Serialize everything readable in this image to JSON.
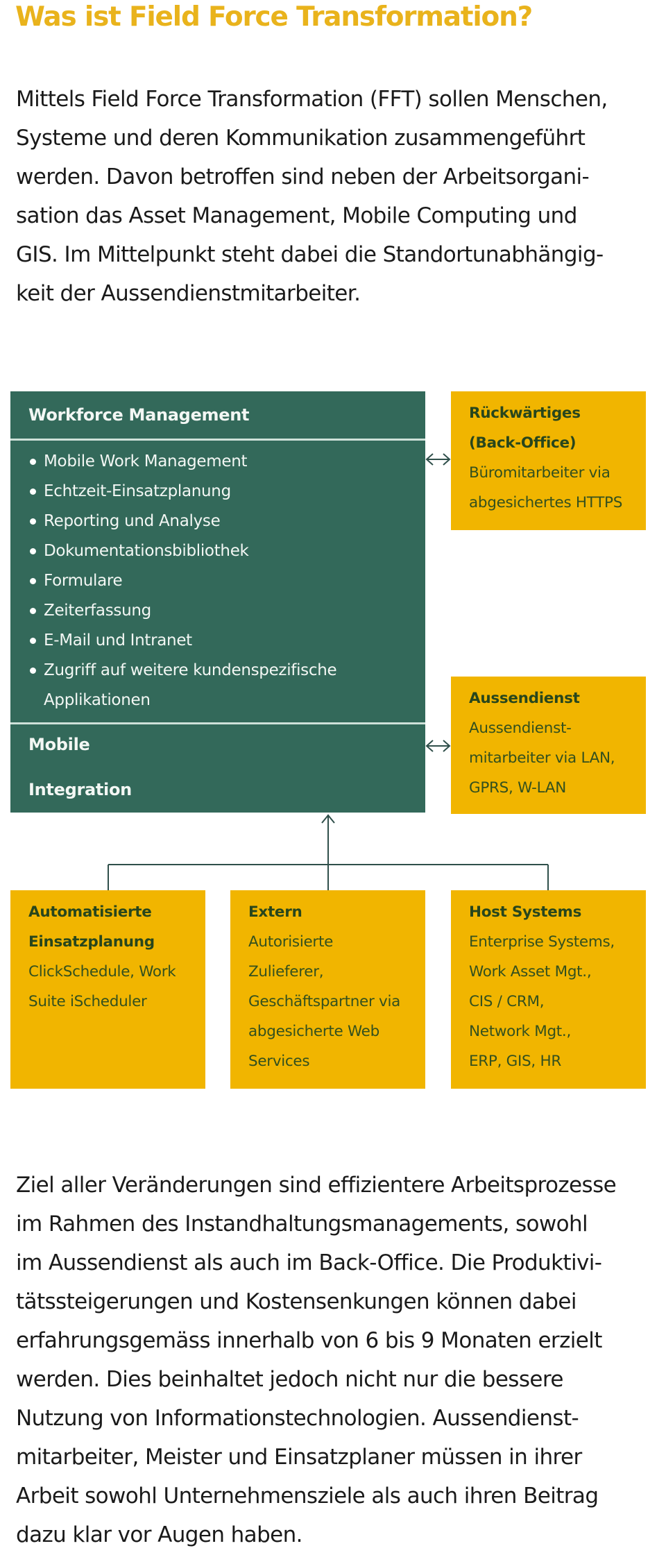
{
  "title": "Was ist Field Force Transformation?",
  "intro_lines": [
    "Mittels Field Force Transformation (FFT) sollen Menschen,",
    "Systeme und deren Kommunikation zusammengeführt",
    "werden. Davon betroffen sind neben der Arbeitsorgani-",
    "sation das Asset Management, Mobile Computing und",
    "GIS. Im Mittelpunkt steht dabei die Standortunabhängig-",
    "keit der Aussendienstmitarbeiter."
  ],
  "diagram": {
    "center": {
      "heading": "Workforce Management",
      "items": [
        "Mobile Work Management",
        "Echtzeit-Einsatzplanung",
        "Reporting und Analyse",
        "Dokumentationsbibliothek",
        "Formulare",
        "Zeiterfassung",
        "E-Mail und Intranet",
        "Zugriff auf weitere kundenspezifische"
      ],
      "item_continuation": "Applikationen",
      "sub_mobile": "Mobile",
      "sub_integration": "Integration"
    },
    "backoffice": {
      "title_lines": [
        "Rückwärtiges",
        "(Back-Office)"
      ],
      "text_lines": [
        "Büromitarbeiter via",
        "abgesichertes HTTPS"
      ]
    },
    "aussendienst": {
      "title_lines": [
        "Aussendienst"
      ],
      "text_lines": [
        "Aussendienst-",
        "mitarbeiter via LAN,",
        "GPRS, W-LAN"
      ]
    },
    "automatisiert": {
      "title_lines": [
        "Automatisierte",
        "Einsatzplanung"
      ],
      "text_lines": [
        "ClickSchedule, Work",
        "Suite iScheduler"
      ]
    },
    "extern": {
      "title_lines": [
        "Extern"
      ],
      "text_lines": [
        "Autorisierte",
        "Zulieferer,",
        "Geschäftspartner via",
        "abgesicherte Web",
        "Services"
      ]
    },
    "host": {
      "title_lines": [
        "Host Systems"
      ],
      "text_lines": [
        "Enterprise Systems,",
        "Work Asset Mgt.,",
        "CIS / CRM,",
        "Network Mgt.,",
        "ERP, GIS, HR"
      ]
    },
    "icons": {
      "bidirectional_arrow": "double-arrow-icon",
      "up_arrow": "arrow-up-icon"
    }
  },
  "outro_lines": [
    "Ziel aller Veränderungen sind effizientere Arbeitsprozesse",
    "im Rahmen des Instandhaltungsmanagements, sowohl",
    "im Aussendienst als auch im Back-Office. Die Produktivi-",
    "tätssteigerungen und Kostensenkungen können dabei",
    "erfahrungsgemäss innerhalb von 6 bis 9 Monaten erzielt",
    "werden. Dies beinhaltet jedoch nicht nur die bessere",
    "Nutzung von Informationstechnologien. Aussendienst-",
    "mitarbeiter, Meister und Einsatzplaner müssen in ihrer",
    "Arbeit sowohl Unternehmensziele als auch ihren Beitrag",
    "dazu klar vor Augen haben."
  ],
  "colors": {
    "title_yellow": "#E9B31C",
    "green_box": "#33695A",
    "yellow_box": "#F1B500",
    "yellow_box_text": "#33501E",
    "connector": "#2f4f4a"
  }
}
